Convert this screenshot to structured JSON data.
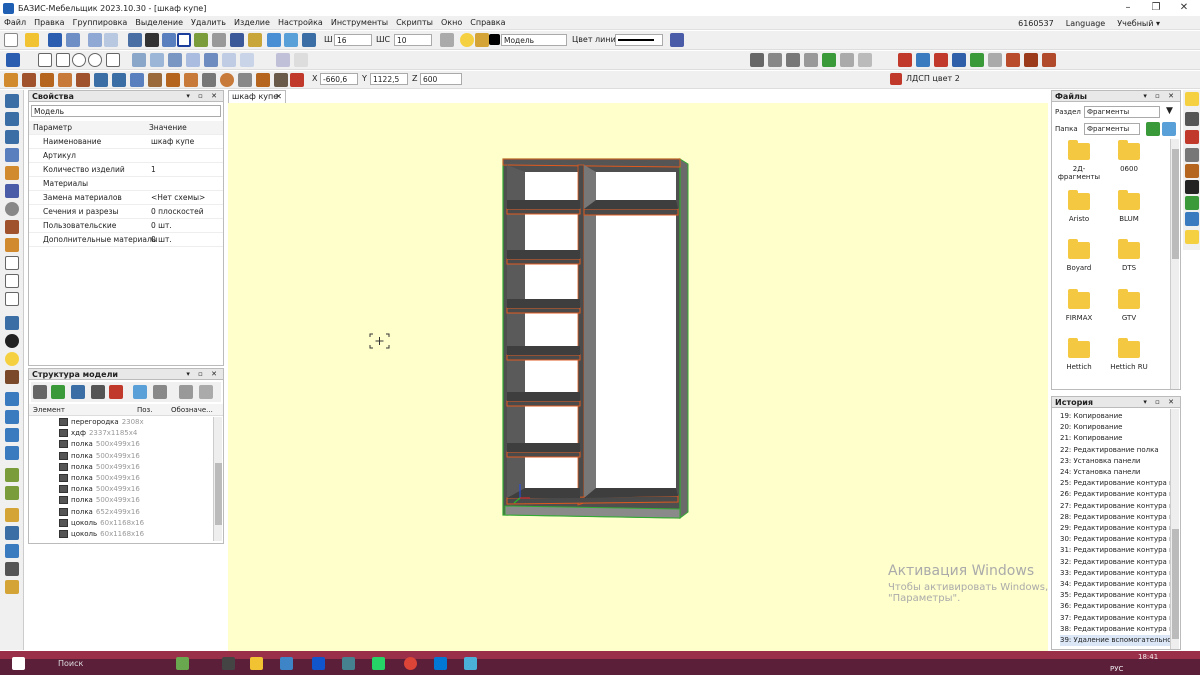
{
  "window": {
    "title": "БАЗИС-Мебельщик 2023.10.30 - [шкаф купе]"
  },
  "menu": [
    "Файл",
    "Правка",
    "Группировка",
    "Выделение",
    "Удалить",
    "Изделие",
    "Настройка",
    "Инструменты",
    "Скрипты",
    "Окно",
    "Справка"
  ],
  "menu_right": {
    "id": "6160537",
    "language": "Language",
    "mode": "Учебный ▾"
  },
  "toolbar": {
    "sh_label": "Ш",
    "sh_value": "16",
    "shs_label": "ШС",
    "shs_value": "10",
    "model_select": "Модель",
    "line_color_label": "Цвет линии",
    "x_label": "X",
    "x_value": "-660,6",
    "y_label": "Y",
    "y_value": "1122,5",
    "z_label": "Z",
    "z_value": "600",
    "material": "ЛДСП цвет 2"
  },
  "properties": {
    "title": "Свойства",
    "select": "Модель",
    "col_param": "Параметр",
    "col_value": "Значение",
    "rows": [
      {
        "name": "Наименование",
        "value": "шкаф купе"
      },
      {
        "name": "Артикул",
        "value": ""
      },
      {
        "name": "Количество изделий",
        "value": "1"
      },
      {
        "name": "Материалы",
        "value": ""
      },
      {
        "name": "Замена материалов",
        "value": "<Нет схемы>"
      },
      {
        "name": "Сечения и разрезы",
        "value": "0 плоскостей"
      },
      {
        "name": "Пользовательские",
        "value": "0 шт."
      },
      {
        "name": "Дополнительные материалы",
        "value": "0 шт."
      }
    ]
  },
  "tree": {
    "title": "Структура модели",
    "col_element": "Элемент",
    "col_pos": "Поз.",
    "col_desig": "Обозначе...",
    "rows": [
      {
        "name": "перегородка",
        "size": "2308x"
      },
      {
        "name": "хдф",
        "size": "2337x1185x4"
      },
      {
        "name": "полка",
        "size": "500x499x16"
      },
      {
        "name": "полка",
        "size": "500x499x16"
      },
      {
        "name": "полка",
        "size": "500x499x16"
      },
      {
        "name": "полка",
        "size": "500x499x16"
      },
      {
        "name": "полка",
        "size": "500x499x16"
      },
      {
        "name": "полка",
        "size": "500x499x16"
      },
      {
        "name": "полка",
        "size": "652x499x16"
      },
      {
        "name": "цоколь",
        "size": "60x1168x16"
      },
      {
        "name": "цоколь",
        "size": "60x1168x16"
      }
    ]
  },
  "doc_tab": "шкаф купе",
  "files": {
    "title": "Файлы",
    "section_label": "Раздел",
    "section_value": "Фрагменты",
    "folder_label": "Папка",
    "folder_value": "Фрагменты",
    "folders": [
      "2Д-фрагменты",
      "0600",
      "Aristo",
      "BLUM",
      "Boyard",
      "DTS",
      "FIRMAX",
      "GTV",
      "Hettich",
      "Hettich RU"
    ]
  },
  "history": {
    "title": "История",
    "items": [
      "19:  Копирование",
      "20:  Копирование",
      "21:  Копирование",
      "22:  Редактирование полка",
      "23:  Установка панели",
      "24:  Установка панели",
      "25:  Редактирование контура и о",
      "26:  Редактирование контура и о",
      "27:  Редактирование контура и о",
      "28:  Редактирование контура и о",
      "29:  Редактирование контура и о",
      "30:  Редактирование контура и о",
      "31:  Редактирование контура и о",
      "32:  Редактирование контура и о",
      "33:  Редактирование контура и о",
      "34:  Редактирование контура и о",
      "35:  Редактирование контура и о",
      "36:  Редактирование контура и о",
      "37:  Редактирование контура и о",
      "38:  Редактирование контура и о",
      "39:  Удаление вспомогательной с"
    ]
  },
  "activation": {
    "title": "Активация Windows",
    "line1": "Чтобы активировать Windows, перейдите в раздел",
    "line2": "\"Параметры\"."
  },
  "taskbar": {
    "search": "Поиск",
    "lang": "РУС",
    "time": "18:41"
  },
  "colors": {
    "viewport": "#ffffcc",
    "panel_edge": "#e05a1e",
    "carcass": "#555555",
    "taskbar": "#5c1f3a"
  }
}
